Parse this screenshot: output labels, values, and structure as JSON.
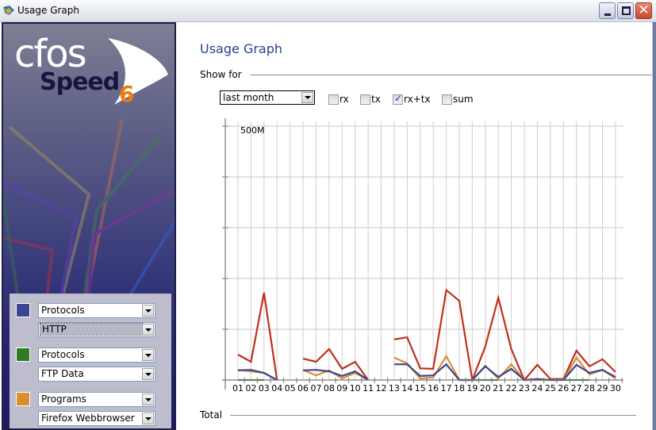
{
  "window": {
    "title": "Usage Graph",
    "controls": {
      "minimize": "minimize-icon",
      "maximize": "maximize-icon",
      "close": "close-icon"
    }
  },
  "sidebar": {
    "logo": {
      "word1": "cfos",
      "word2": "Speed",
      "version": "6"
    },
    "filters": [
      {
        "color": "#3b4590",
        "category": "Protocols",
        "item": "HTTP",
        "focused": true
      },
      {
        "color": "#2e7a25",
        "category": "Protocols",
        "item": "FTP Data",
        "focused": false
      },
      {
        "color": "#d98e32",
        "category": "Programs",
        "item": "Firefox Webbrowser",
        "focused": false
      }
    ]
  },
  "main": {
    "title": "Usage Graph",
    "show_for_label": "Show for",
    "period": {
      "selected": "last month"
    },
    "checkboxes": [
      {
        "label": "rx",
        "checked": false
      },
      {
        "label": "tx",
        "checked": false
      },
      {
        "label": "rx+tx",
        "checked": true
      },
      {
        "label": "sum",
        "checked": false
      }
    ],
    "total_label": "Total"
  },
  "chart_data": {
    "type": "line",
    "title": "",
    "xlabel": "",
    "ylabel": "",
    "x": [
      "01",
      "02",
      "03",
      "04",
      "05",
      "06",
      "07",
      "08",
      "09",
      "10",
      "11",
      "12",
      "13",
      "14",
      "15",
      "16",
      "17",
      "18",
      "19",
      "20",
      "21",
      "22",
      "23",
      "24",
      "25",
      "26",
      "27",
      "28",
      "29",
      "30"
    ],
    "ylim": [
      0,
      500
    ],
    "y_unit": "M",
    "y_tick_labels": [
      {
        "value": 500,
        "label": "500M"
      }
    ],
    "y_gridlines": [
      0,
      100,
      200,
      300,
      400,
      500
    ],
    "grid": true,
    "legend": "none",
    "series": [
      {
        "name": "Total",
        "color": "#c0301c",
        "values": [
          50,
          36,
          172,
          0,
          null,
          42,
          36,
          61,
          22,
          36,
          0,
          null,
          80,
          84,
          23,
          22,
          177,
          156,
          0,
          66,
          162,
          61,
          0,
          30,
          2,
          2,
          58,
          27,
          41,
          16
        ]
      },
      {
        "name": "Firefox Webbrowser",
        "color": "#d98e32",
        "values": [
          20,
          17,
          14,
          0,
          null,
          20,
          9,
          19,
          3,
          14,
          0,
          null,
          44,
          33,
          3,
          5,
          47,
          0,
          0,
          28,
          3,
          31,
          0,
          0,
          0,
          0,
          44,
          11,
          20,
          3
        ]
      },
      {
        "name": "HTTP",
        "color": "#3b4590",
        "values": [
          19,
          20,
          14,
          0,
          null,
          19,
          20,
          17,
          8,
          17,
          0,
          null,
          31,
          31,
          8,
          9,
          31,
          0,
          0,
          27,
          6,
          22,
          0,
          2,
          0,
          0,
          30,
          14,
          20,
          6
        ]
      },
      {
        "name": "FTP Data",
        "color": "#3c9a38",
        "values": [
          0,
          0,
          0,
          null,
          null,
          null,
          null,
          null,
          null,
          null,
          null,
          null,
          null,
          null,
          null,
          null,
          null,
          null,
          0,
          0,
          0,
          null,
          null,
          null,
          null,
          0,
          0,
          0,
          null,
          null
        ]
      }
    ]
  }
}
